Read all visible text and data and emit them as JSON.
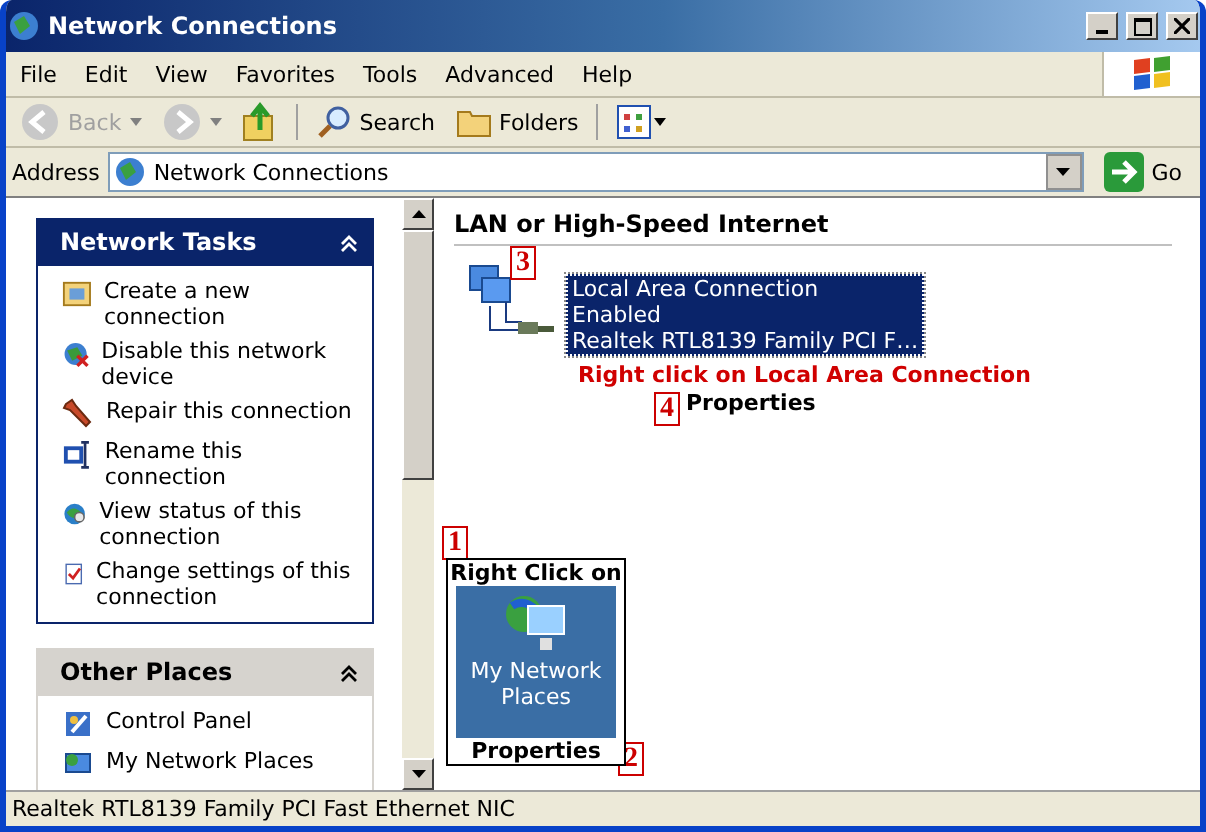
{
  "window": {
    "title": "Network Connections"
  },
  "menu": [
    "File",
    "Edit",
    "View",
    "Favorites",
    "Tools",
    "Advanced",
    "Help"
  ],
  "toolbar": [
    {
      "kind": "back",
      "label": "Back",
      "disabled": true
    },
    {
      "kind": "forward",
      "disabled": true
    },
    {
      "kind": "up"
    },
    {
      "kind": "search",
      "label": "Search"
    },
    {
      "kind": "folders",
      "label": "Folders"
    },
    {
      "kind": "views"
    }
  ],
  "address": {
    "label": "Address",
    "value": "Network Connections",
    "go": "Go"
  },
  "sidebar": [
    {
      "title": "Network Tasks",
      "expanded": true,
      "kind": "special",
      "items": [
        {
          "label": "Create a new connection"
        },
        {
          "label": "Disable this network device"
        },
        {
          "label": "Repair this connection"
        },
        {
          "label": "Rename this connection"
        },
        {
          "label": "View status of this connection"
        },
        {
          "label": "Change settings of this connection"
        }
      ]
    },
    {
      "title": "Other Places",
      "expanded": true,
      "kind": "normal",
      "items": [
        {
          "label": "Control Panel"
        },
        {
          "label": "My Network Places"
        }
      ]
    }
  ],
  "group": {
    "title": "LAN or High-Speed Internet"
  },
  "connection": {
    "selected": true,
    "lines": [
      "Local Area Connection",
      "Enabled",
      "Realtek RTL8139 Family PCI F…"
    ]
  },
  "annotations": [
    {
      "kind": "number",
      "text": "3"
    },
    {
      "kind": "note",
      "text": "Right click on Local Area Connection"
    },
    {
      "kind": "number",
      "text": "4"
    },
    {
      "kind": "label",
      "text": "Properties"
    },
    {
      "kind": "number",
      "text": "1"
    },
    {
      "kind": "number",
      "text": "2"
    }
  ],
  "desktop_callout": {
    "top": "Right Click on",
    "icon_label": "My Network Places",
    "bottom": "Properties"
  },
  "status_bar": "Realtek RTL8139 Family PCI Fast Ethernet NIC"
}
